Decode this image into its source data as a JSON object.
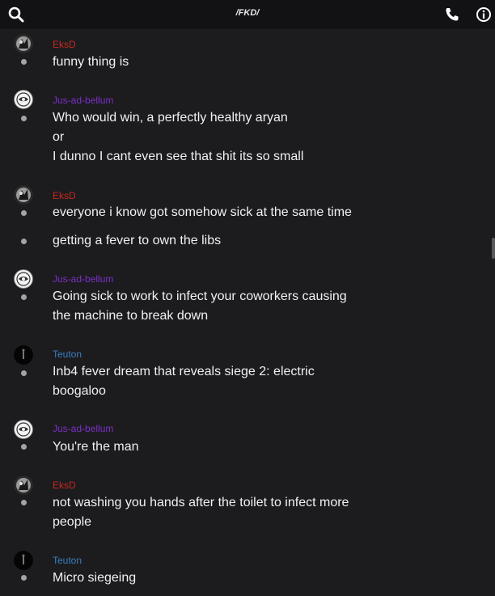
{
  "header": {
    "title": "/FKD/"
  },
  "icons": {
    "search": "search-icon",
    "call": "phone-icon",
    "info": "info-icon"
  },
  "colors": {
    "background": "#1c1c1f",
    "topbar": "#121214",
    "author_eksd": "#c8281e",
    "author_jus": "#7a2fc4",
    "author_teuton": "#3a7fc1"
  },
  "messages": [
    {
      "author": "EksD",
      "lines": [
        "funny thing is"
      ]
    },
    {
      "author": "Jus-ad-bellum",
      "lines": [
        "Who would win, a perfectly healthy aryan",
        "or",
        "I dunno I cant even see that shit its so small"
      ]
    },
    {
      "author": "EksD",
      "lines": [
        "everyone i know got somehow sick at the same time"
      ]
    },
    {
      "lines": [
        "getting a fever to own the libs"
      ]
    },
    {
      "author": "Jus-ad-bellum",
      "lines": [
        "Going sick to work to infect your coworkers causing",
        "the machine to break down"
      ]
    },
    {
      "author": "Teuton",
      "lines": [
        "Inb4 fever dream that reveals siege 2: electric",
        "boogaloo"
      ]
    },
    {
      "author": "Jus-ad-bellum",
      "lines": [
        "You're the man"
      ]
    },
    {
      "author": "EksD",
      "lines": [
        "not washing you hands after the toilet to infect more",
        "people"
      ]
    },
    {
      "author": "Teuton",
      "lines": [
        "Micro siegeing"
      ]
    }
  ]
}
